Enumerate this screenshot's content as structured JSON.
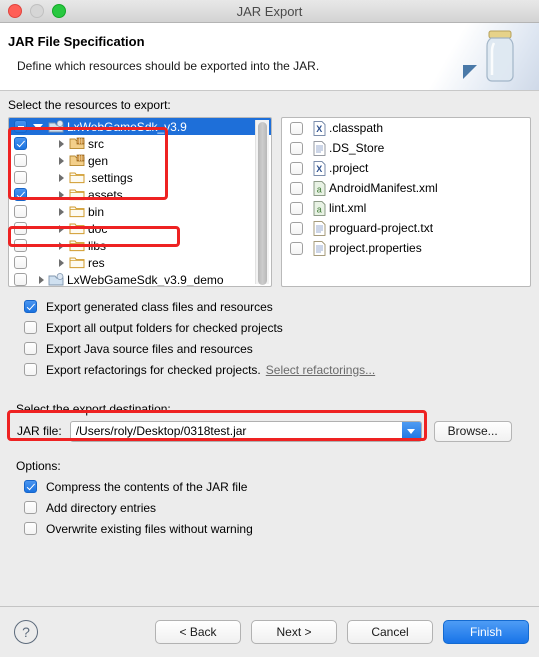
{
  "window": {
    "title": "JAR Export",
    "traffic_lights": [
      "close-red",
      "minimize-gray",
      "zoom-green"
    ]
  },
  "header": {
    "title": "JAR File Specification",
    "subtitle": "Define which resources should be exported into the JAR.",
    "icon": "jar-jar-icon"
  },
  "resources": {
    "label": "Select the resources to export:",
    "tree": [
      {
        "label": "LxWebGameSdk_v3.9",
        "state": "partial",
        "icon": "java-project-icon",
        "twisty": "open",
        "indent": 0,
        "selected": true
      },
      {
        "label": "src",
        "state": "checked",
        "icon": "source-folder-icon",
        "twisty": "closed",
        "indent": 1,
        "selected": false
      },
      {
        "label": "gen",
        "state": "unchecked",
        "icon": "source-folder-icon",
        "twisty": "closed",
        "indent": 1,
        "selected": false
      },
      {
        "label": ".settings",
        "state": "unchecked",
        "icon": "folder-icon",
        "twisty": "closed",
        "indent": 1,
        "selected": false
      },
      {
        "label": "assets",
        "state": "checked",
        "icon": "folder-icon",
        "twisty": "closed",
        "indent": 1,
        "selected": false
      },
      {
        "label": "bin",
        "state": "unchecked",
        "icon": "folder-icon",
        "twisty": "closed",
        "indent": 1,
        "selected": false
      },
      {
        "label": "doc",
        "state": "unchecked",
        "icon": "folder-icon",
        "twisty": "closed",
        "indent": 1,
        "selected": false
      },
      {
        "label": "libs",
        "state": "unchecked",
        "icon": "folder-icon",
        "twisty": "closed",
        "indent": 1,
        "selected": false
      },
      {
        "label": "res",
        "state": "unchecked",
        "icon": "folder-icon",
        "twisty": "closed",
        "indent": 1,
        "selected": false
      },
      {
        "label": "LxWebGameSdk_v3.9_demo",
        "state": "unchecked",
        "icon": "java-project-icon",
        "twisty": "closed",
        "indent": 0,
        "selected": false
      }
    ],
    "files": [
      {
        "label": ".classpath",
        "state": "unchecked",
        "icon": "xml-x-file-icon"
      },
      {
        "label": ".DS_Store",
        "state": "unchecked",
        "icon": "text-file-icon"
      },
      {
        "label": ".project",
        "state": "unchecked",
        "icon": "xml-x-file-icon"
      },
      {
        "label": "AndroidManifest.xml",
        "state": "unchecked",
        "icon": "android-xml-file-icon"
      },
      {
        "label": "lint.xml",
        "state": "unchecked",
        "icon": "android-xml-file-icon"
      },
      {
        "label": "proguard-project.txt",
        "state": "unchecked",
        "icon": "text-file-icon"
      },
      {
        "label": "project.properties",
        "state": "unchecked",
        "icon": "text-file-icon"
      }
    ]
  },
  "export_options": [
    {
      "label": "Export generated class files and resources",
      "state": "checked"
    },
    {
      "label": "Export all output folders for checked projects",
      "state": "unchecked"
    },
    {
      "label": "Export Java source files and resources",
      "state": "unchecked"
    },
    {
      "label": "Export refactorings for checked projects.",
      "state": "unchecked",
      "link": "Select refactorings..."
    }
  ],
  "destination": {
    "label": "Select the export destination:",
    "jar_label": "JAR file:",
    "jar_value": "/Users/roly/Desktop/0318test.jar",
    "jar_placeholder": "",
    "browse_label": "Browse..."
  },
  "options": {
    "label": "Options:",
    "items": [
      {
        "label": "Compress the contents of the JAR file",
        "state": "checked"
      },
      {
        "label": "Add directory entries",
        "state": "unchecked"
      },
      {
        "label": "Overwrite existing files without warning",
        "state": "unchecked"
      }
    ]
  },
  "footer": {
    "help": "?",
    "buttons": [
      {
        "label": "< Back",
        "primary": false
      },
      {
        "label": "Next >",
        "primary": false
      },
      {
        "label": "Cancel",
        "primary": false
      },
      {
        "label": "Finish",
        "primary": true
      }
    ]
  },
  "annotations": {
    "color": "#ee2222",
    "boxes": [
      "tree-src-to-assets-highlight",
      "tree-libs-highlight",
      "jar-file-row-highlight"
    ]
  }
}
